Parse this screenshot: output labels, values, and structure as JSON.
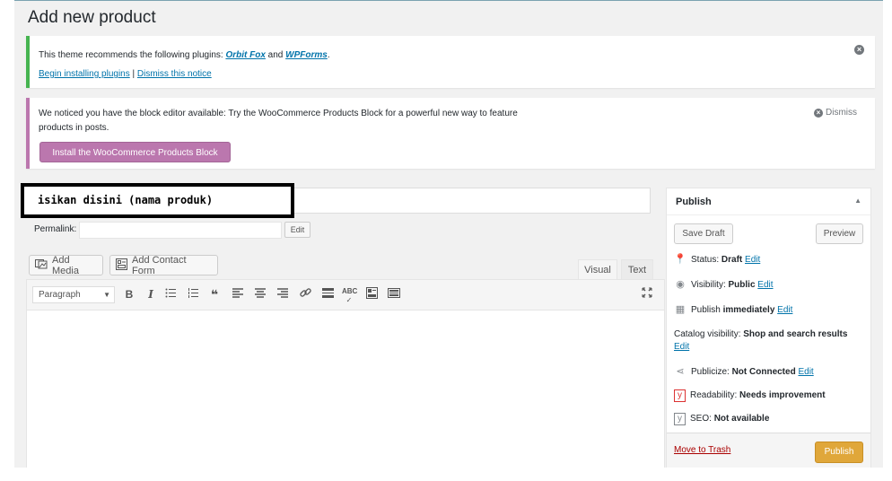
{
  "page": {
    "title": "Add new product"
  },
  "notice_plugins": {
    "text_prefix": "This theme recommends the following plugins: ",
    "plugin1": "Orbit Fox",
    "and": " and ",
    "plugin2": "WPForms",
    "period": ".",
    "begin_link": "Begin installing plugins",
    "separator": " | ",
    "dismiss_link": "Dismiss this notice"
  },
  "notice_woo": {
    "line1": "We noticed you have the block editor available: Try the WooCommerce Products Block for a powerful new way to feature",
    "line2": "products in posts.",
    "dismiss": "Dismiss",
    "install_button": "Install the WooCommerce Products Block"
  },
  "title_field": {
    "overlay_text": "isikan disini (nama produk)"
  },
  "permalink": {
    "label": "Permalink:",
    "edit": "Edit"
  },
  "media": {
    "add_media": "Add Media",
    "add_contact_form": "Add Contact Form"
  },
  "editor": {
    "tab_visual": "Visual",
    "tab_text": "Text",
    "format_select": "Paragraph"
  },
  "publish": {
    "title": "Publish",
    "save_draft": "Save Draft",
    "preview": "Preview",
    "status_label": "Status: ",
    "status_value": "Draft",
    "visibility_label": "Visibility: ",
    "visibility_value": "Public",
    "publish_label": "Publish ",
    "publish_value": "immediately",
    "catalog_label": "Catalog visibility: ",
    "catalog_value": "Shop and search results",
    "publicize_label": "Publicize: ",
    "publicize_value": "Not Connected",
    "readability_label": "Readability: ",
    "readability_value": "Needs improvement",
    "seo_label": "SEO: ",
    "seo_value": "Not available",
    "edit": "Edit",
    "move_to_trash": "Move to Trash",
    "publish_button": "Publish"
  },
  "colors": {
    "accent_link": "#0073aa",
    "notice_success": "#46b450",
    "woo_purple": "#bb77ae",
    "publish_orange": "#e0a73a",
    "trash_red": "#aa0000"
  },
  "icons": {
    "toolbar": [
      "bold-icon",
      "italic-icon",
      "bullet-list-icon",
      "numbered-list-icon",
      "blockquote-icon",
      "align-left-icon",
      "align-center-icon",
      "align-right-icon",
      "link-icon",
      "read-more-icon",
      "spellcheck-icon",
      "toolbar-toggle-icon",
      "keyboard-icon",
      "fullscreen-icon"
    ]
  }
}
